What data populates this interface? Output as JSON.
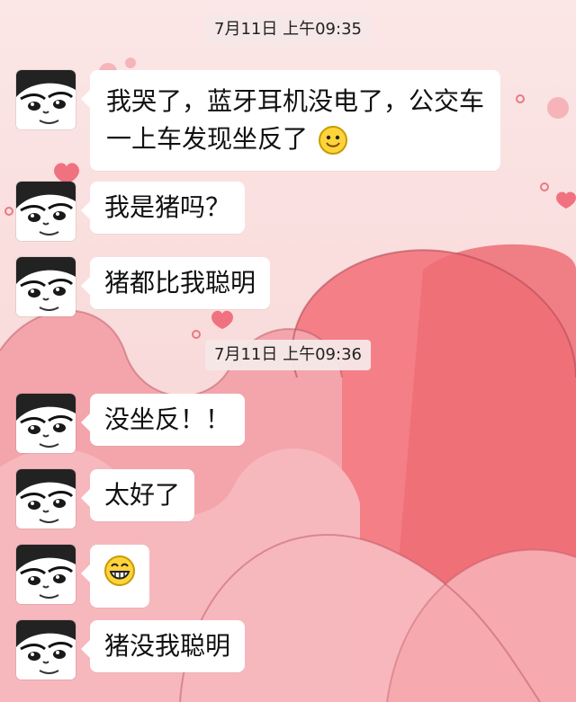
{
  "timestamps": [
    "7月11日 上午09:35",
    "7月11日 上午09:36"
  ],
  "messages": [
    {
      "text": "我哭了，蓝牙耳机没电了，公交车一上车发现坐反了",
      "emoji": "smile-face"
    },
    {
      "text": "我是猪吗？"
    },
    {
      "text": "猪都比我聪明"
    },
    {
      "text": "没坐反！！"
    },
    {
      "text": "太好了"
    },
    {
      "emoji": "grin-face"
    },
    {
      "text": "猪没我聪明"
    }
  ]
}
